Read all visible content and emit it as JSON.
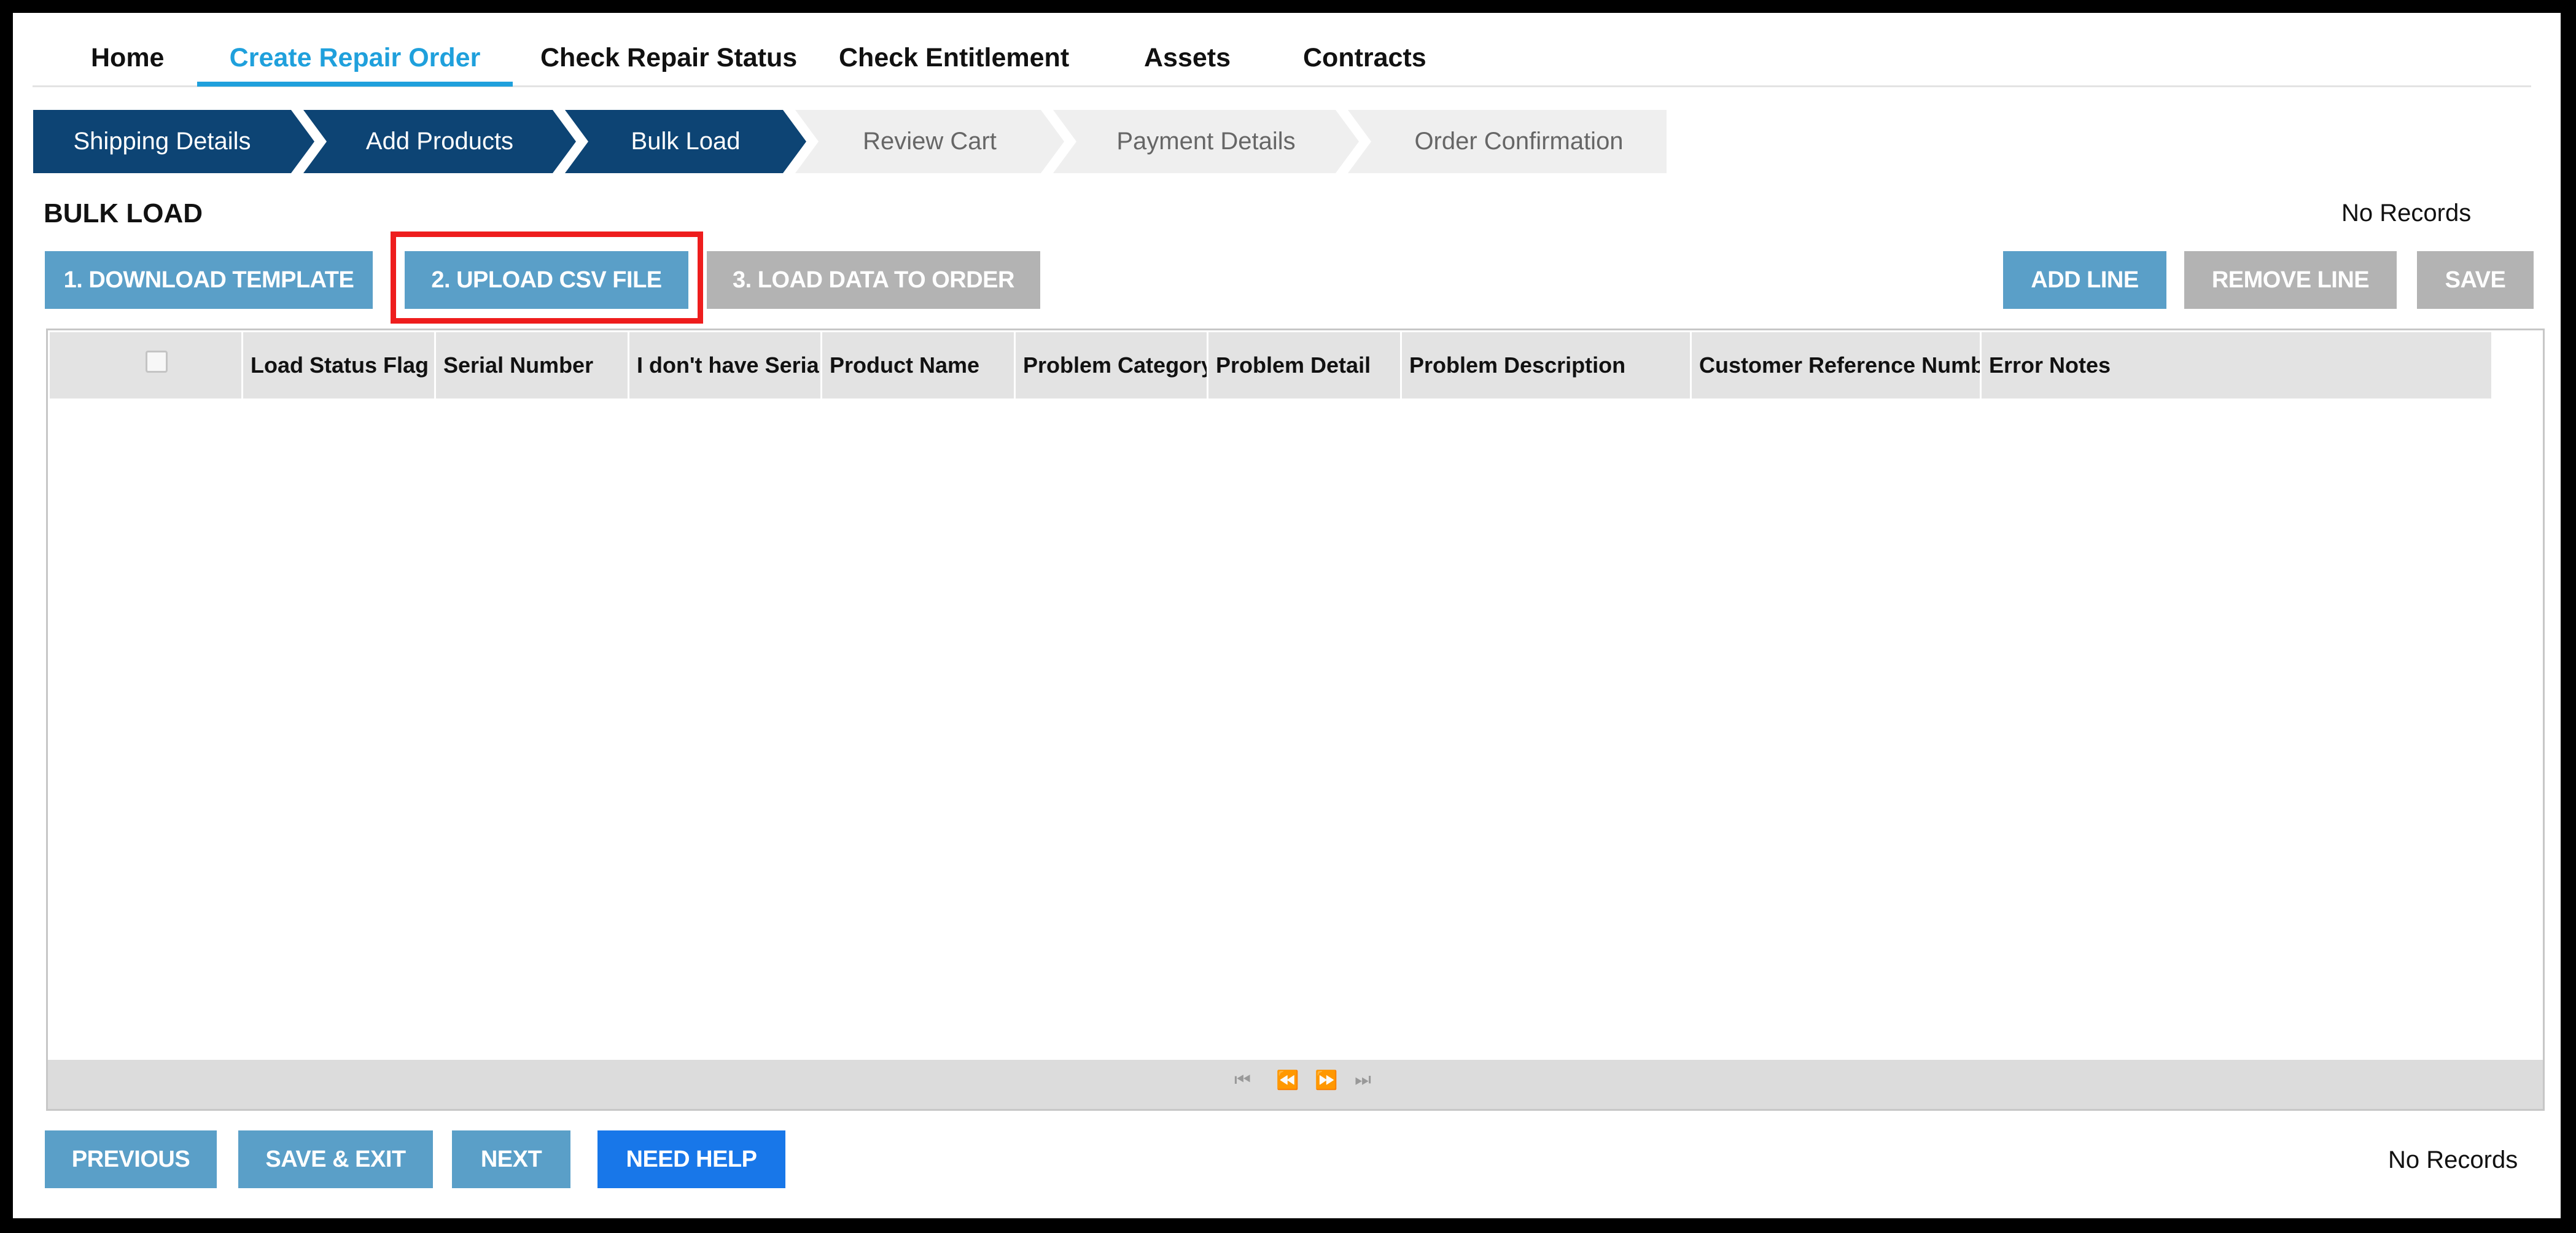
{
  "nav": {
    "items": [
      {
        "label": "Home",
        "active": false
      },
      {
        "label": "Create Repair Order",
        "active": true
      },
      {
        "label": "Check Repair Status",
        "active": false
      },
      {
        "label": "Check Entitlement",
        "active": false
      },
      {
        "label": "Assets",
        "active": false
      },
      {
        "label": "Contracts",
        "active": false
      }
    ]
  },
  "steps": [
    {
      "label": "Shipping Details",
      "state": "done"
    },
    {
      "label": "Add Products",
      "state": "done"
    },
    {
      "label": "Bulk Load",
      "state": "done"
    },
    {
      "label": "Review Cart",
      "state": "todo"
    },
    {
      "label": "Payment Details",
      "state": "todo"
    },
    {
      "label": "Order Confirmation",
      "state": "todo"
    }
  ],
  "page": {
    "title": "BULK LOAD",
    "records_top": "No Records",
    "records_bottom": "No Records"
  },
  "toolbar": {
    "download_template": "1. DOWNLOAD TEMPLATE",
    "upload_csv": "2. UPLOAD CSV FILE",
    "load_data": "3. LOAD DATA TO ORDER",
    "add_line": "ADD LINE",
    "remove_line": "REMOVE LINE",
    "save": "SAVE"
  },
  "grid": {
    "columns": [
      "Load Status Flag",
      "Serial Number",
      "I don't have Serial",
      "Product Name",
      "Problem Category",
      "Problem Detail",
      "Problem Description",
      "Customer Reference Number",
      "Error Notes"
    ],
    "rows": [],
    "pager_icons": [
      "first-page-icon",
      "prev-page-icon",
      "next-page-icon",
      "last-page-icon"
    ]
  },
  "footer": {
    "previous": "PREVIOUS",
    "save_exit": "SAVE & EXIT",
    "next": "NEXT",
    "need_help": "NEED HELP"
  },
  "colors": {
    "accent": "#1fa0dc",
    "step_done": "#0d4474",
    "button_blue": "#5a9fc8",
    "button_disabled": "#b3b3b3",
    "help_button": "#1877e9",
    "highlight": "#ee1d1d"
  }
}
